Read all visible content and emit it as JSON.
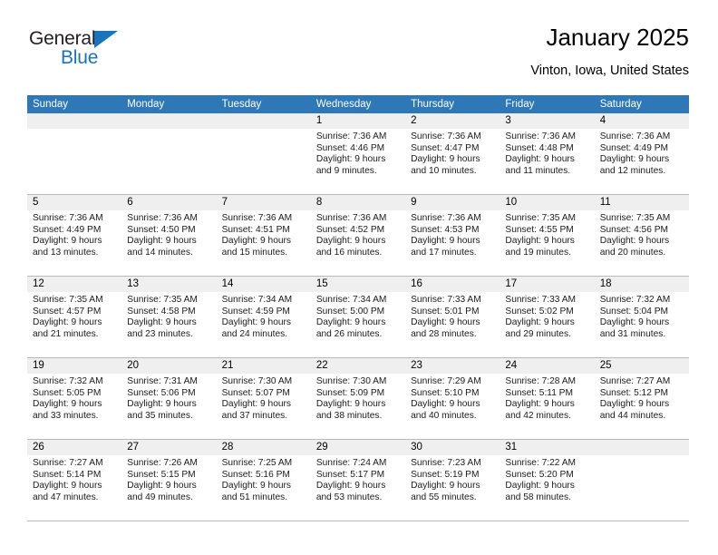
{
  "brand": {
    "name_top": "General",
    "name_bottom": "Blue",
    "triangle_icon": "blue-triangle-logo-mark",
    "color_dark": "#231f20",
    "color_blue": "#1a74bb"
  },
  "header": {
    "title": "January 2025",
    "subtitle": "Vinton, Iowa, United States"
  },
  "theme": {
    "header_blue": "#2e78b8",
    "daynum_gray": "#efefef",
    "grid_line": "#b9b9b9"
  },
  "weekdays": [
    "Sunday",
    "Monday",
    "Tuesday",
    "Wednesday",
    "Thursday",
    "Friday",
    "Saturday"
  ],
  "weeks": [
    [
      {
        "day": "",
        "sunrise": "",
        "sunset": "",
        "daylight": "",
        "empty": true
      },
      {
        "day": "",
        "sunrise": "",
        "sunset": "",
        "daylight": "",
        "empty": true
      },
      {
        "day": "",
        "sunrise": "",
        "sunset": "",
        "daylight": "",
        "empty": true
      },
      {
        "day": "1",
        "sunrise": "Sunrise: 7:36 AM",
        "sunset": "Sunset: 4:46 PM",
        "daylight": "Daylight: 9 hours and 9 minutes."
      },
      {
        "day": "2",
        "sunrise": "Sunrise: 7:36 AM",
        "sunset": "Sunset: 4:47 PM",
        "daylight": "Daylight: 9 hours and 10 minutes."
      },
      {
        "day": "3",
        "sunrise": "Sunrise: 7:36 AM",
        "sunset": "Sunset: 4:48 PM",
        "daylight": "Daylight: 9 hours and 11 minutes."
      },
      {
        "day": "4",
        "sunrise": "Sunrise: 7:36 AM",
        "sunset": "Sunset: 4:49 PM",
        "daylight": "Daylight: 9 hours and 12 minutes."
      }
    ],
    [
      {
        "day": "5",
        "sunrise": "Sunrise: 7:36 AM",
        "sunset": "Sunset: 4:49 PM",
        "daylight": "Daylight: 9 hours and 13 minutes."
      },
      {
        "day": "6",
        "sunrise": "Sunrise: 7:36 AM",
        "sunset": "Sunset: 4:50 PM",
        "daylight": "Daylight: 9 hours and 14 minutes."
      },
      {
        "day": "7",
        "sunrise": "Sunrise: 7:36 AM",
        "sunset": "Sunset: 4:51 PM",
        "daylight": "Daylight: 9 hours and 15 minutes."
      },
      {
        "day": "8",
        "sunrise": "Sunrise: 7:36 AM",
        "sunset": "Sunset: 4:52 PM",
        "daylight": "Daylight: 9 hours and 16 minutes."
      },
      {
        "day": "9",
        "sunrise": "Sunrise: 7:36 AM",
        "sunset": "Sunset: 4:53 PM",
        "daylight": "Daylight: 9 hours and 17 minutes."
      },
      {
        "day": "10",
        "sunrise": "Sunrise: 7:35 AM",
        "sunset": "Sunset: 4:55 PM",
        "daylight": "Daylight: 9 hours and 19 minutes."
      },
      {
        "day": "11",
        "sunrise": "Sunrise: 7:35 AM",
        "sunset": "Sunset: 4:56 PM",
        "daylight": "Daylight: 9 hours and 20 minutes."
      }
    ],
    [
      {
        "day": "12",
        "sunrise": "Sunrise: 7:35 AM",
        "sunset": "Sunset: 4:57 PM",
        "daylight": "Daylight: 9 hours and 21 minutes."
      },
      {
        "day": "13",
        "sunrise": "Sunrise: 7:35 AM",
        "sunset": "Sunset: 4:58 PM",
        "daylight": "Daylight: 9 hours and 23 minutes."
      },
      {
        "day": "14",
        "sunrise": "Sunrise: 7:34 AM",
        "sunset": "Sunset: 4:59 PM",
        "daylight": "Daylight: 9 hours and 24 minutes."
      },
      {
        "day": "15",
        "sunrise": "Sunrise: 7:34 AM",
        "sunset": "Sunset: 5:00 PM",
        "daylight": "Daylight: 9 hours and 26 minutes."
      },
      {
        "day": "16",
        "sunrise": "Sunrise: 7:33 AM",
        "sunset": "Sunset: 5:01 PM",
        "daylight": "Daylight: 9 hours and 28 minutes."
      },
      {
        "day": "17",
        "sunrise": "Sunrise: 7:33 AM",
        "sunset": "Sunset: 5:02 PM",
        "daylight": "Daylight: 9 hours and 29 minutes."
      },
      {
        "day": "18",
        "sunrise": "Sunrise: 7:32 AM",
        "sunset": "Sunset: 5:04 PM",
        "daylight": "Daylight: 9 hours and 31 minutes."
      }
    ],
    [
      {
        "day": "19",
        "sunrise": "Sunrise: 7:32 AM",
        "sunset": "Sunset: 5:05 PM",
        "daylight": "Daylight: 9 hours and 33 minutes."
      },
      {
        "day": "20",
        "sunrise": "Sunrise: 7:31 AM",
        "sunset": "Sunset: 5:06 PM",
        "daylight": "Daylight: 9 hours and 35 minutes."
      },
      {
        "day": "21",
        "sunrise": "Sunrise: 7:30 AM",
        "sunset": "Sunset: 5:07 PM",
        "daylight": "Daylight: 9 hours and 37 minutes."
      },
      {
        "day": "22",
        "sunrise": "Sunrise: 7:30 AM",
        "sunset": "Sunset: 5:09 PM",
        "daylight": "Daylight: 9 hours and 38 minutes."
      },
      {
        "day": "23",
        "sunrise": "Sunrise: 7:29 AM",
        "sunset": "Sunset: 5:10 PM",
        "daylight": "Daylight: 9 hours and 40 minutes."
      },
      {
        "day": "24",
        "sunrise": "Sunrise: 7:28 AM",
        "sunset": "Sunset: 5:11 PM",
        "daylight": "Daylight: 9 hours and 42 minutes."
      },
      {
        "day": "25",
        "sunrise": "Sunrise: 7:27 AM",
        "sunset": "Sunset: 5:12 PM",
        "daylight": "Daylight: 9 hours and 44 minutes."
      }
    ],
    [
      {
        "day": "26",
        "sunrise": "Sunrise: 7:27 AM",
        "sunset": "Sunset: 5:14 PM",
        "daylight": "Daylight: 9 hours and 47 minutes."
      },
      {
        "day": "27",
        "sunrise": "Sunrise: 7:26 AM",
        "sunset": "Sunset: 5:15 PM",
        "daylight": "Daylight: 9 hours and 49 minutes."
      },
      {
        "day": "28",
        "sunrise": "Sunrise: 7:25 AM",
        "sunset": "Sunset: 5:16 PM",
        "daylight": "Daylight: 9 hours and 51 minutes."
      },
      {
        "day": "29",
        "sunrise": "Sunrise: 7:24 AM",
        "sunset": "Sunset: 5:17 PM",
        "daylight": "Daylight: 9 hours and 53 minutes."
      },
      {
        "day": "30",
        "sunrise": "Sunrise: 7:23 AM",
        "sunset": "Sunset: 5:19 PM",
        "daylight": "Daylight: 9 hours and 55 minutes."
      },
      {
        "day": "31",
        "sunrise": "Sunrise: 7:22 AM",
        "sunset": "Sunset: 5:20 PM",
        "daylight": "Daylight: 9 hours and 58 minutes."
      },
      {
        "day": "",
        "sunrise": "",
        "sunset": "",
        "daylight": "",
        "empty": true
      }
    ]
  ]
}
